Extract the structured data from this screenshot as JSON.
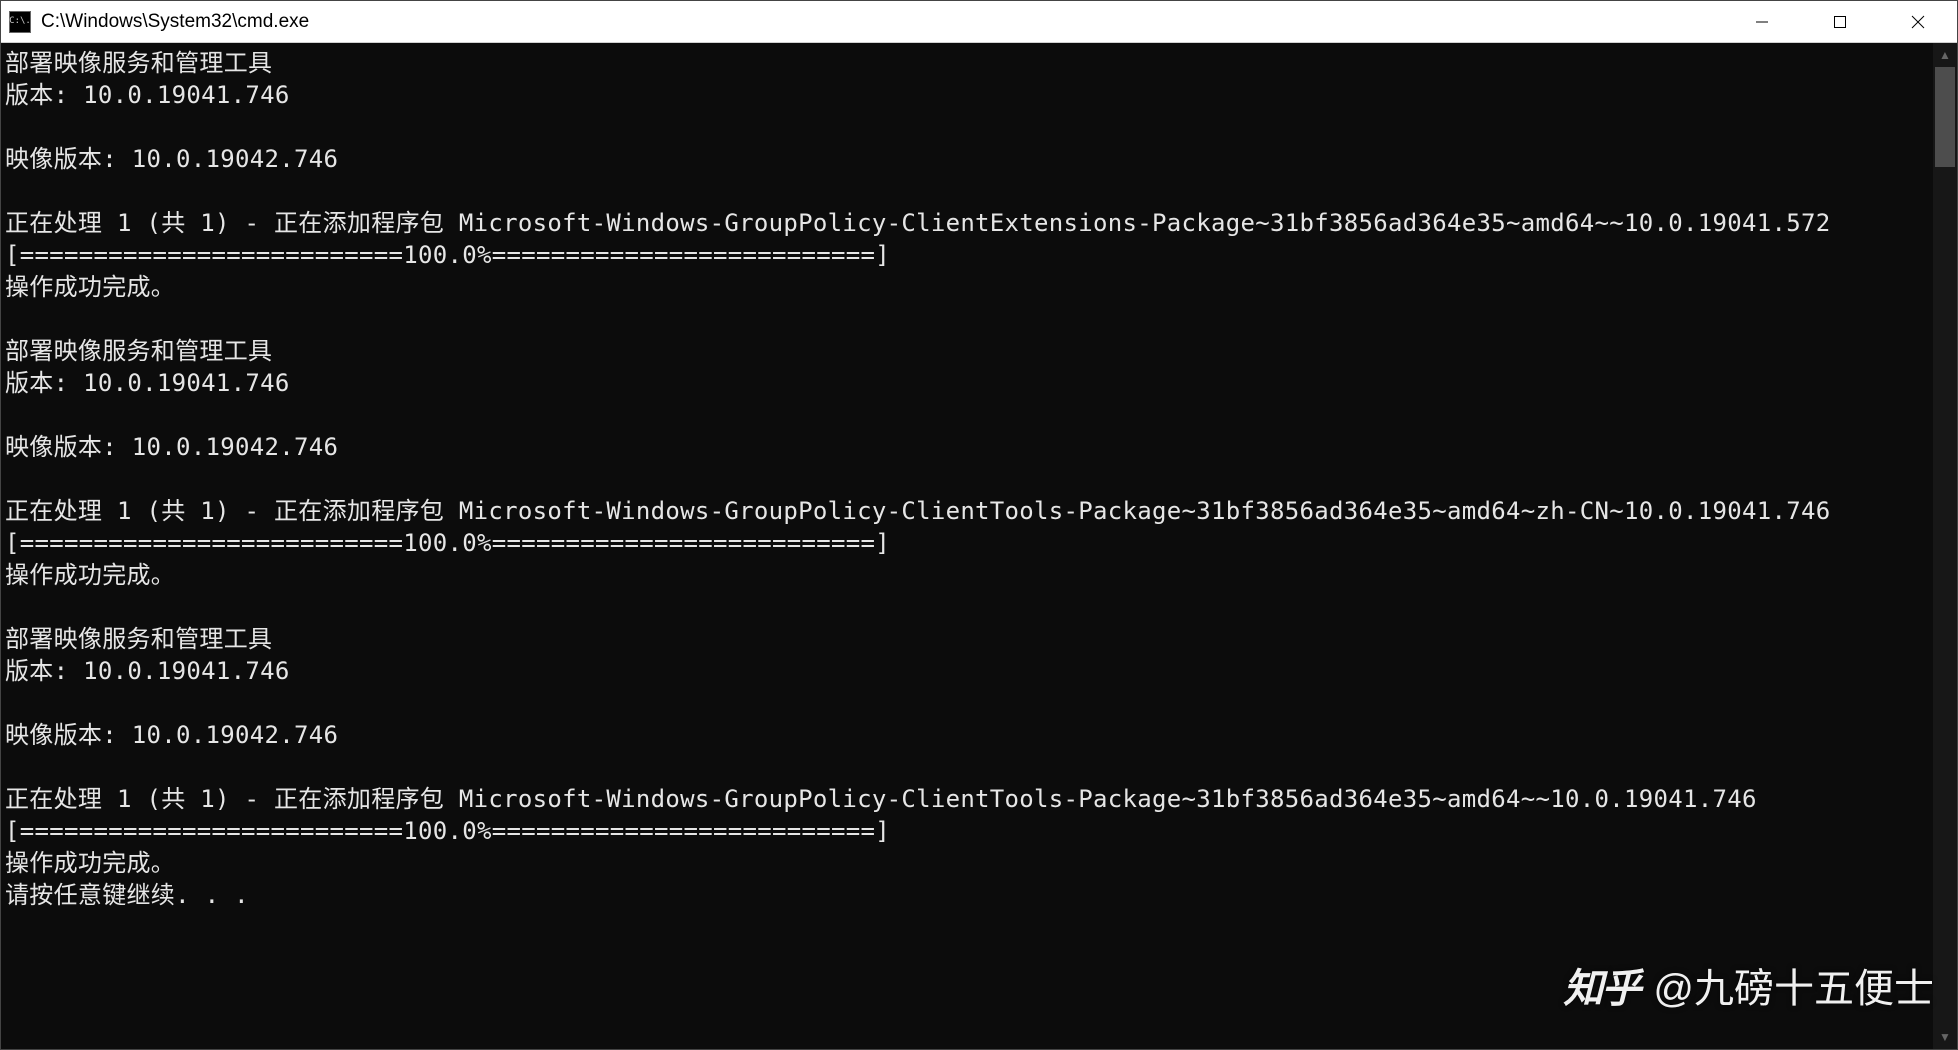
{
  "window": {
    "title": "C:\\Windows\\System32\\cmd.exe",
    "icon_text": "C:\\."
  },
  "terminal": {
    "lines": [
      "部署映像服务和管理工具",
      "版本: 10.0.19041.746",
      "",
      "映像版本: 10.0.19042.746",
      "",
      "正在处理 1 (共 1) - 正在添加程序包 Microsoft-Windows-GroupPolicy-ClientExtensions-Package~31bf3856ad364e35~amd64~~10.0.19041.572",
      "[==========================100.0%==========================]",
      "操作成功完成。",
      "",
      "部署映像服务和管理工具",
      "版本: 10.0.19041.746",
      "",
      "映像版本: 10.0.19042.746",
      "",
      "正在处理 1 (共 1) - 正在添加程序包 Microsoft-Windows-GroupPolicy-ClientTools-Package~31bf3856ad364e35~amd64~zh-CN~10.0.19041.746",
      "[==========================100.0%==========================]",
      "操作成功完成。",
      "",
      "部署映像服务和管理工具",
      "版本: 10.0.19041.746",
      "",
      "映像版本: 10.0.19042.746",
      "",
      "正在处理 1 (共 1) - 正在添加程序包 Microsoft-Windows-GroupPolicy-ClientTools-Package~31bf3856ad364e35~amd64~~10.0.19041.746",
      "[==========================100.0%==========================]",
      "操作成功完成。",
      "请按任意键继续. . ."
    ]
  },
  "watermark": {
    "logo": "知乎",
    "author": "@九磅十五便士"
  }
}
